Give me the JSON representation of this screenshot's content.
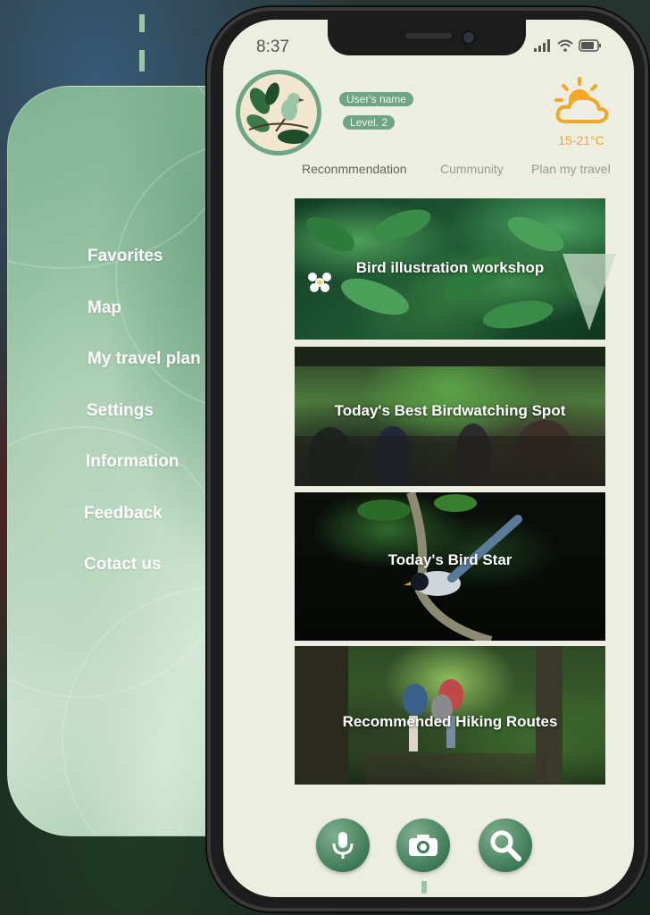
{
  "status_bar": {
    "time": "8:37"
  },
  "profile": {
    "user_name": "User's name",
    "level": "Level. 2"
  },
  "weather": {
    "icon": "partly-sunny-icon",
    "temperature": "15-21°C",
    "color": "#f5a623"
  },
  "tabs": [
    {
      "label": "Reconmmendation",
      "active": true
    },
    {
      "label": "Cummunity",
      "active": false
    },
    {
      "label": "Plan my travel",
      "active": false
    }
  ],
  "cards": [
    {
      "title": "Bird illustration workshop"
    },
    {
      "title": "Today's Best Birdwatching Spot"
    },
    {
      "title": "Today's Bird Star"
    },
    {
      "title": "Recommended Hiking Routes"
    }
  ],
  "side_menu": {
    "items": [
      {
        "label": "Favorites"
      },
      {
        "label": "Map"
      },
      {
        "label": "My travel plan"
      },
      {
        "label": "Settings"
      },
      {
        "label": "Information"
      },
      {
        "label": "Feedback"
      },
      {
        "label": "Cotact us"
      }
    ]
  },
  "bottom_bar": {
    "buttons": [
      {
        "icon": "microphone-icon"
      },
      {
        "icon": "camera-icon"
      },
      {
        "icon": "search-icon"
      }
    ]
  },
  "colors": {
    "accent": "#6ea584",
    "screen_bg": "#edeee2",
    "sun": "#f5a623"
  }
}
